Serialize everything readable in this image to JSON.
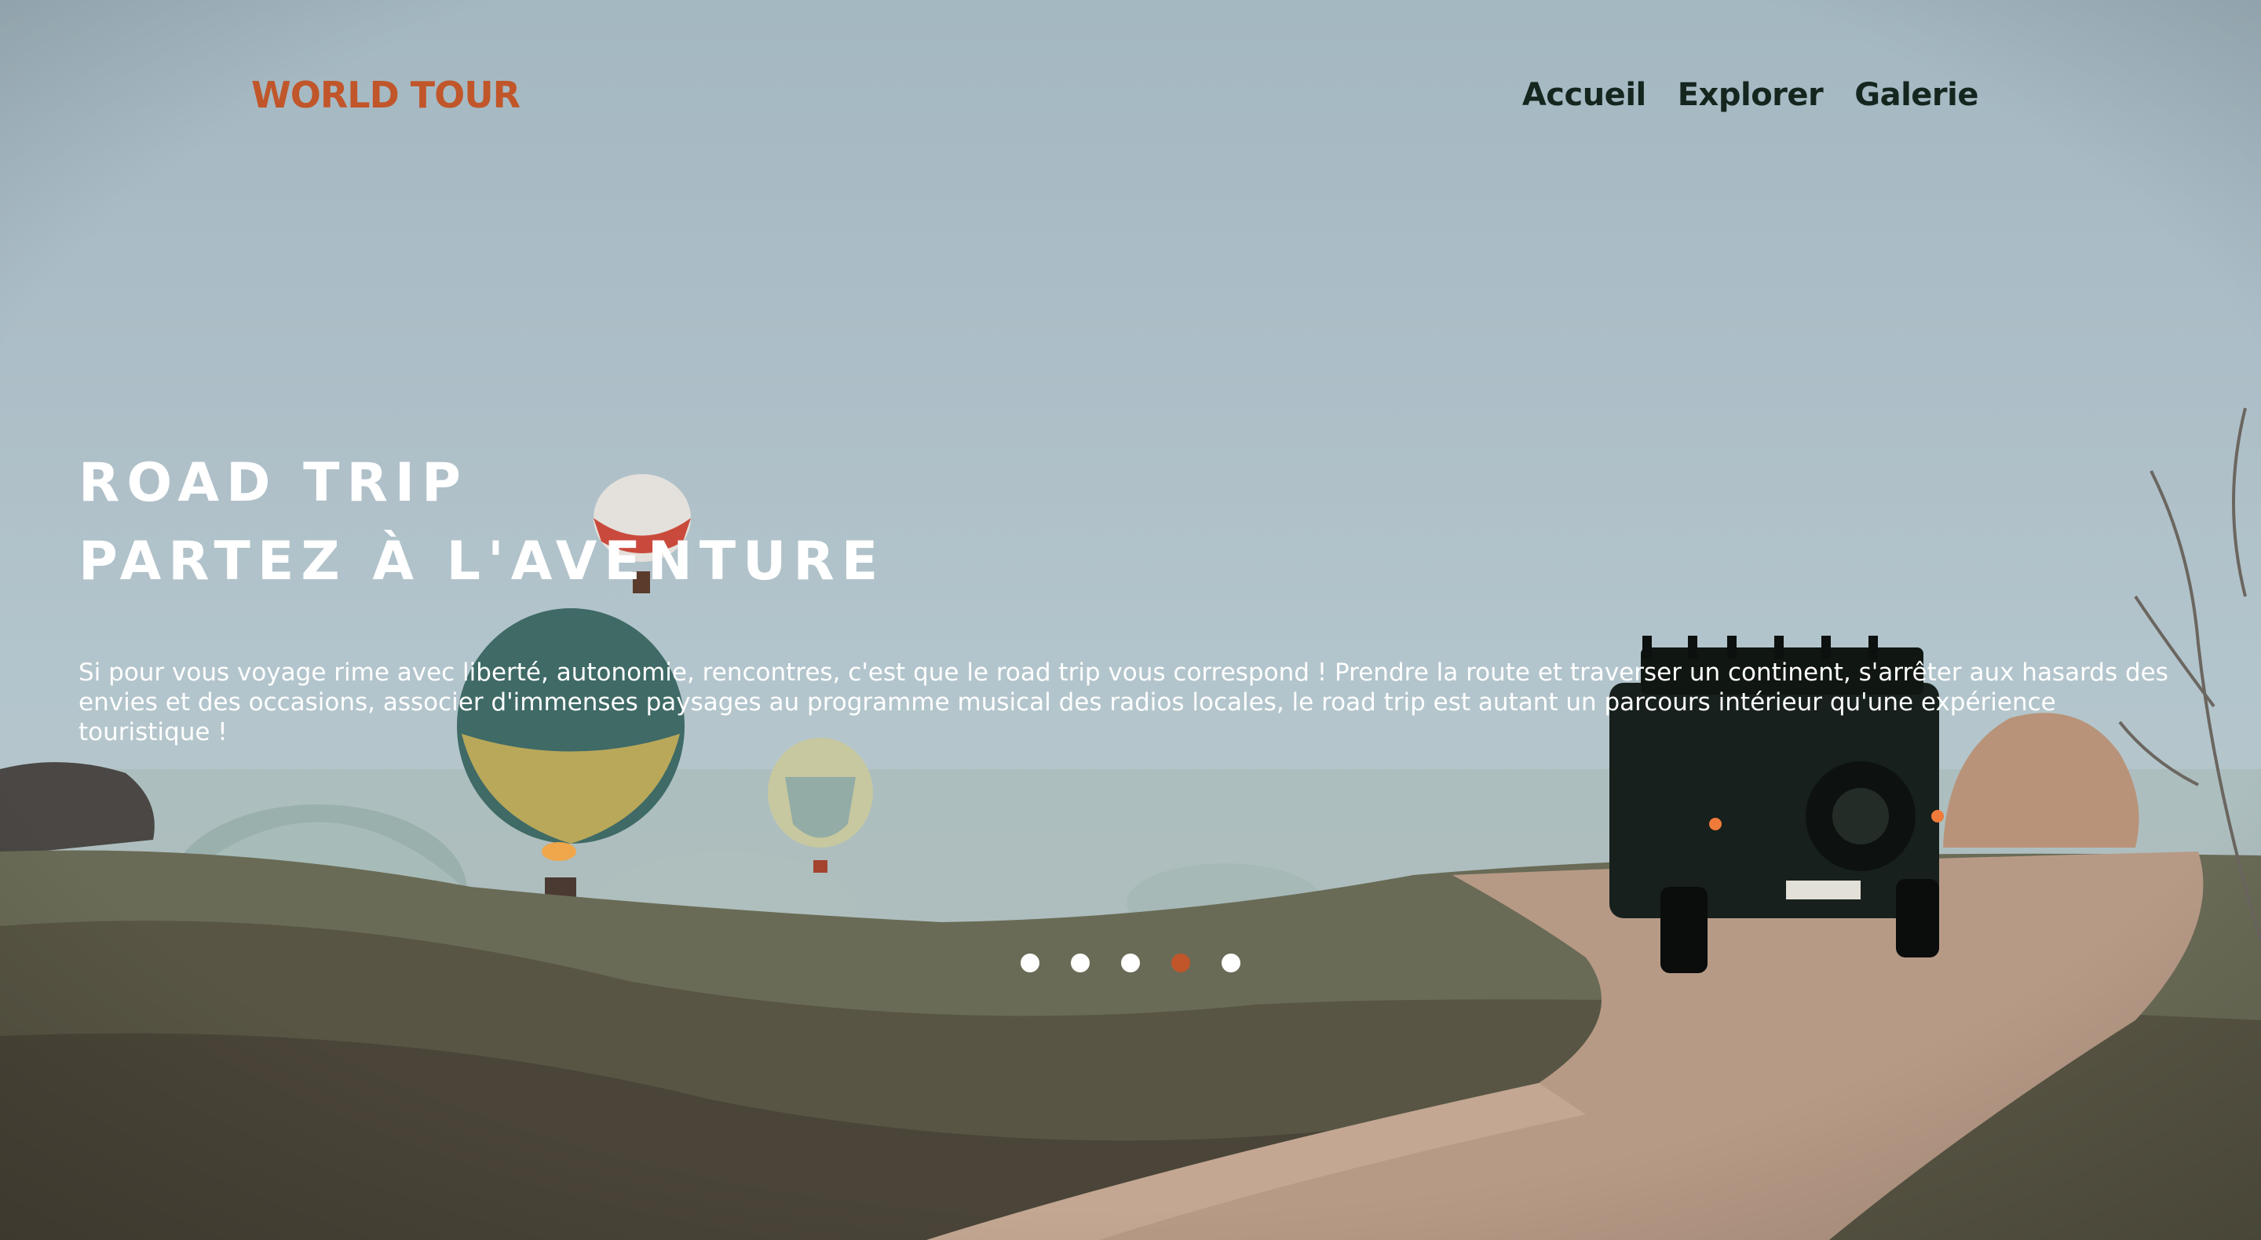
{
  "brand": {
    "name": "WORLD TOUR",
    "color": "#c0562a"
  },
  "nav": {
    "items": [
      {
        "label": "Accueil"
      },
      {
        "label": "Explorer"
      },
      {
        "label": "Galerie"
      }
    ]
  },
  "hero": {
    "title_line1": "ROAD TRIP",
    "title_line2": "PARTEZ À L'AVENTURE",
    "description": "Si pour vous voyage rime avec liberté, autonomie, rencontres, c'est que le road trip vous correspond ! Prendre la route et traverser un continent, s'arrêter aux hasards des envies et des occasions, associer d'immenses paysages au programme musical des radios locales, le road trip est autant un parcours intérieur qu'une expérience touristique !",
    "background_icon": "hot-air-balloons-and-jeep-landscape"
  },
  "slider": {
    "slide_count": 5,
    "active_index": 4,
    "dot_color": "#ffffff",
    "active_dot_color": "#c0562a"
  }
}
